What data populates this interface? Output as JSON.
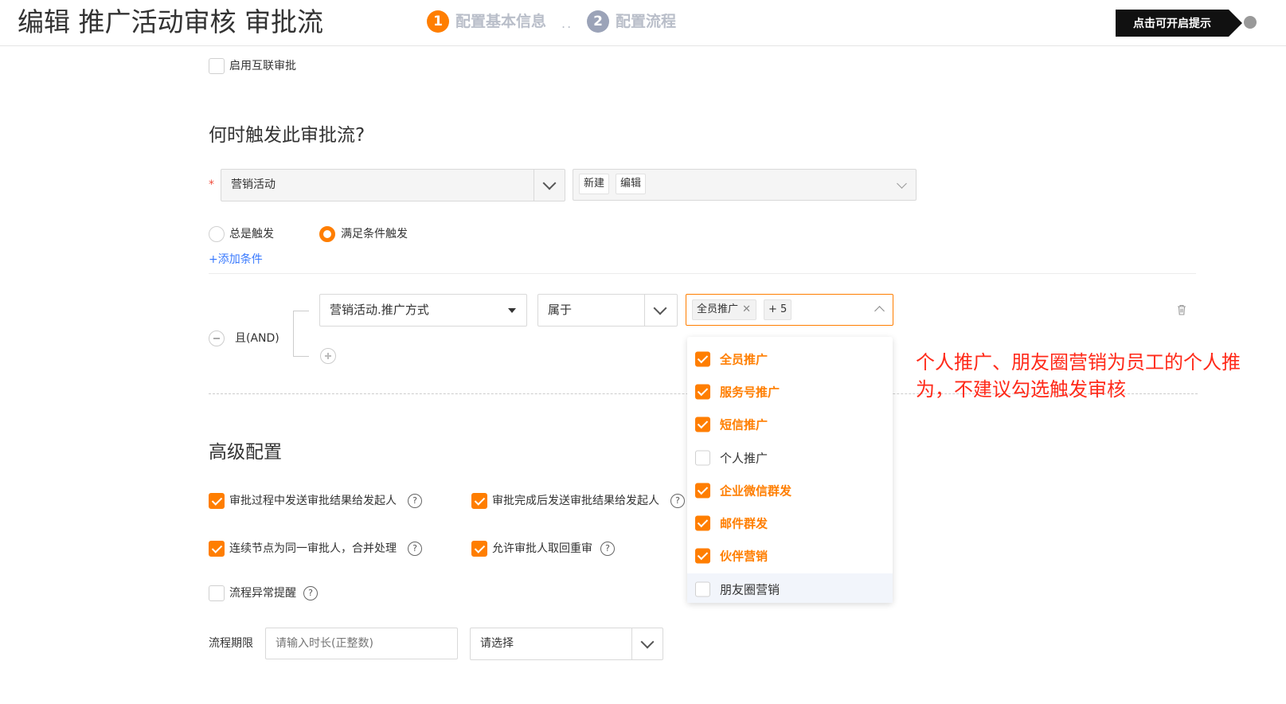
{
  "header": {
    "title": "编辑 推广活动审核 审批流",
    "steps": [
      {
        "num": "1",
        "label": "配置基本信息",
        "color": "#ff7e00"
      },
      {
        "num": "2",
        "label": "配置流程",
        "color": "#9ba3b8"
      }
    ],
    "step_separator": "..",
    "hint_button": "点击可开启提示"
  },
  "interconnect": {
    "label": "启用互联审批",
    "checked": false
  },
  "trigger": {
    "section_title": "何时触发此审批流?",
    "required_mark": "*",
    "object_select": "营销活动",
    "action_tags": [
      "新建",
      "编辑"
    ],
    "radio_always": "总是触发",
    "radio_condition": "满足条件触发",
    "selected_radio": "满足条件触发",
    "add_condition": "+添加条件"
  },
  "condition": {
    "logic_label": "且(AND)",
    "field_select": "营销活动.推广方式",
    "operator_select": "属于",
    "value_tag": "全员推广",
    "value_more": "+ 5"
  },
  "dropdown": {
    "options": [
      {
        "label": "全员推广",
        "checked": true
      },
      {
        "label": "服务号推广",
        "checked": true
      },
      {
        "label": "短信推广",
        "checked": true
      },
      {
        "label": "个人推广",
        "checked": false
      },
      {
        "label": "企业微信群发",
        "checked": true
      },
      {
        "label": "邮件群发",
        "checked": true
      },
      {
        "label": "伙伴营销",
        "checked": true
      },
      {
        "label": "朋友圈营销",
        "checked": false
      }
    ]
  },
  "annotation": {
    "line1": "个人推广、朋友圈营销为员工的个人推",
    "line2": "为，不建议勾选触发审核",
    "color": "#ff2a1a"
  },
  "advanced": {
    "section_title": "高级配置",
    "options": [
      {
        "label": "审批过程中发送审批结果给发起人",
        "checked": true
      },
      {
        "label": "审批完成后发送审批结果给发起人",
        "checked": true
      },
      {
        "label": "连续节点为同一审批人，合并处理",
        "checked": true
      },
      {
        "label": "允许审批人取回重审",
        "checked": true
      },
      {
        "label": "流程异常提醒",
        "checked": false
      }
    ],
    "help_glyph": "?",
    "deadline_label": "流程期限",
    "deadline_placeholder": "请输入时长(正整数)",
    "unit_select": "请选择"
  },
  "colors": {
    "accent": "#ff7e00",
    "link": "#3a7afe"
  }
}
